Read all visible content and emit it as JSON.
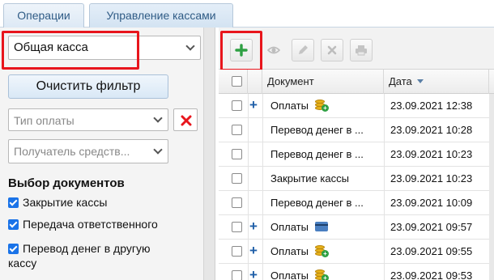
{
  "tabs": [
    {
      "label": "Операции"
    },
    {
      "label": "Управление кассами"
    }
  ],
  "filter": {
    "cashbox_select": "Общая касса",
    "clear_button": "Очистить фильтр",
    "payment_type_placeholder": "Тип оплаты",
    "recipient_placeholder": "Получатель средств...",
    "section_title": "Выбор документов",
    "checkboxes": [
      {
        "label": "Закрытие кассы",
        "checked": true
      },
      {
        "label": "Передача ответственного",
        "checked": true
      },
      {
        "label": "Перевод денег в другую кассу",
        "checked": true
      }
    ]
  },
  "toolbar": {
    "icons": [
      "add-icon",
      "view-icon",
      "edit-icon",
      "delete-icon",
      "print-icon"
    ]
  },
  "grid": {
    "columns": [
      "Документ",
      "Дата"
    ],
    "rows": [
      {
        "expandable": true,
        "document": "Оплаты",
        "icon": "coins-add-icon",
        "date": "23.09.2021 12:38"
      },
      {
        "expandable": false,
        "document": "Перевод денег в ...",
        "icon": "",
        "date": "23.09.2021 10:28"
      },
      {
        "expandable": false,
        "document": "Перевод денег в ...",
        "icon": "",
        "date": "23.09.2021 10:23"
      },
      {
        "expandable": false,
        "document": "Закрытие кассы",
        "icon": "",
        "date": "23.09.2021 10:23"
      },
      {
        "expandable": false,
        "document": "Перевод денег в ...",
        "icon": "",
        "date": "23.09.2021 10:09"
      },
      {
        "expandable": true,
        "document": "Оплаты",
        "icon": "card-icon",
        "date": "23.09.2021 09:57"
      },
      {
        "expandable": true,
        "document": "Оплаты",
        "icon": "coins-add-icon",
        "date": "23.09.2021 09:55"
      },
      {
        "expandable": true,
        "document": "Оплаты",
        "icon": "coins-add-icon",
        "date": "23.09.2021 09:53"
      }
    ]
  },
  "colors": {
    "highlight": "#e8151c",
    "accent": "#1a73e8",
    "add_green": "#2ea043"
  }
}
